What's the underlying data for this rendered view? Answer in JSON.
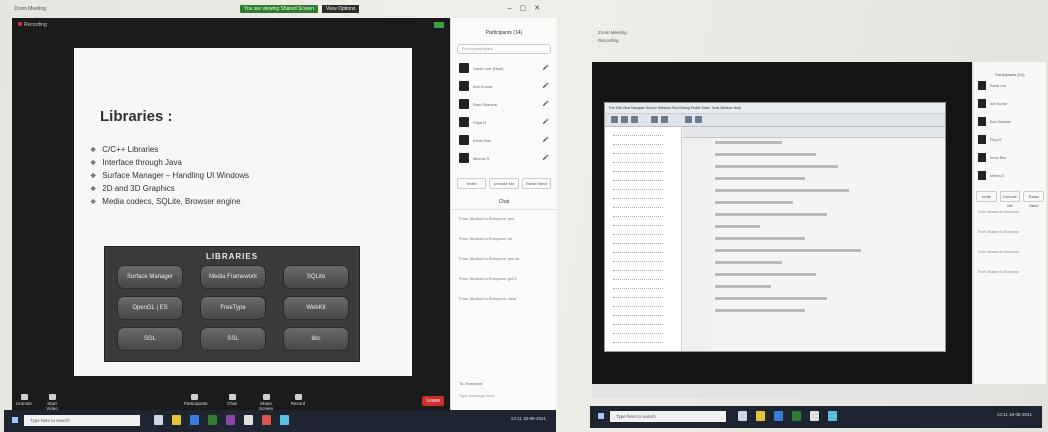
{
  "left_monitor": {
    "window_title": "Zoom Meeting",
    "share_banner": "You are viewing Shared Screen",
    "view_options": "View Options",
    "recording": "Recording",
    "slide": {
      "title": "Libraries :",
      "bullets": [
        "C/C++ Libraries",
        "Interface through Java",
        "Surface Manager – Handling UI Windows",
        "2D and 3D Graphics",
        "Media codecs, SQLite, Browser engine"
      ],
      "diagram_title": "LIBRARIES",
      "diagram_items": [
        "Surface Manager",
        "Media Framework",
        "SQLite",
        "OpenGL | ES",
        "FreeType",
        "WebKit",
        "SGL",
        "SSL",
        "libc"
      ]
    },
    "toolbar": [
      {
        "label": "Unmute",
        "icon": "microphone-icon"
      },
      {
        "label": "Start Video",
        "icon": "video-icon"
      },
      {
        "label": "Participants",
        "icon": "participants-icon"
      },
      {
        "label": "Chat",
        "icon": "chat-icon"
      },
      {
        "label": "Share Screen",
        "icon": "share-screen-icon"
      },
      {
        "label": "Record",
        "icon": "record-icon"
      }
    ],
    "leave_label": "Leave",
    "panel": {
      "title": "Participants (14)",
      "search_placeholder": "Find a participant",
      "participants": [
        "Sarah Lee (Host)",
        "Anil Kumar",
        "Ravi Shankar",
        "Priya R",
        "Kevin Rao",
        "Meena S"
      ],
      "buttons": [
        "Invite",
        "Unmute Me",
        "Raise Hand"
      ],
      "chat_title": "Chat",
      "messages": [
        "From Student to Everyone: yes",
        "From Student to Everyone: ok",
        "From Student to Everyone: yes sir",
        "From Student to Everyone: got it",
        "From Student to Everyone: clear"
      ],
      "to_label": "To: Everyone",
      "input_placeholder": "Type message here..."
    },
    "taskbar": {
      "search_placeholder": "Type here to search",
      "time": "13:11",
      "date": "18-08-2021",
      "icon_colors": [
        "#cfd6e0",
        "#e6c13a",
        "#3b7ddd",
        "#2e7d32",
        "#8e44ad",
        "#e0e0e0",
        "#d9534f",
        "#f0ad4e",
        "#5bc0de",
        "#ffffff"
      ]
    }
  },
  "right_monitor": {
    "window_title": "Zoom Meeting",
    "recording": "Recording",
    "ide_menu": "File  Edit  View  Navigate  Source  Refactor  Run  Debug  Profile  Team  Tools  Window  Help",
    "panel_title": "Participants (14)",
    "participants": [
      "Sarah Lee",
      "Anil Kumar",
      "Ravi Shankar",
      "Priya R",
      "Kevin Rao",
      "Meena S"
    ],
    "buttons": [
      "Invite",
      "Unmute Me",
      "Raise Hand"
    ],
    "messages": [
      "From Student to Everyone",
      "From Student to Everyone",
      "From Student to Everyone",
      "From Student to Everyone"
    ],
    "taskbar": {
      "search_placeholder": "Type here to search",
      "time": "13:11",
      "date": "18-08-2021"
    }
  }
}
